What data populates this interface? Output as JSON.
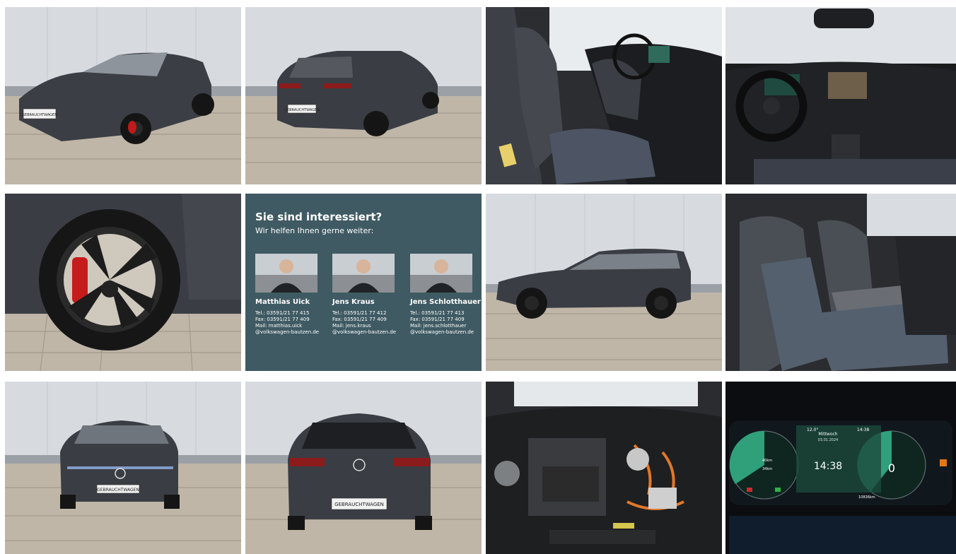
{
  "photos": [
    {
      "name": "front-three-quarter-photo",
      "plate": "GEBRAUCHTWAGEN"
    },
    {
      "name": "rear-three-quarter-photo",
      "plate": "GEBRAUCHTWAGEN"
    },
    {
      "name": "front-seats-photo"
    },
    {
      "name": "dashboard-photo"
    },
    {
      "name": "wheel-photo"
    },
    {
      "name": "side-profile-photo"
    },
    {
      "name": "rear-seats-photo"
    },
    {
      "name": "front-view-photo",
      "plate": "GEBRAUCHTWAGEN"
    },
    {
      "name": "rear-view-photo",
      "plate": "GEBRAUCHTWAGEN"
    },
    {
      "name": "engine-bay-photo"
    },
    {
      "name": "digital-cockpit-photo",
      "day": "Mittwoch",
      "date": "03.01.2024",
      "clock": "14:38",
      "temp": "12.0°",
      "speed": "0",
      "range1": "40km",
      "range2": "34km",
      "odo": "10836km",
      "time_top": "14:38"
    }
  ],
  "contact": {
    "title": "Sie sind interessiert?",
    "subtitle": "Wir helfen Ihnen gerne weiter:",
    "people": [
      {
        "name": "Matthias Uick",
        "tel": "Tel.:  03591/21 77 415",
        "fax": "Fax:  03591/21 77 409",
        "mail": "Mail: matthias.uick",
        "domain": "@volkswagen-bautzen.de"
      },
      {
        "name": "Jens Kraus",
        "tel": "Tel.:     03591/21 77 412",
        "fax": "Fax:     03591/21 77 409",
        "mail": "Mail:    jens.kraus",
        "domain": "@volkswagen-bautzen.de"
      },
      {
        "name": "Jens Schlotthauer",
        "tel": "Tel.:  03591/21 77 413",
        "fax": "Fax:  03591/21 77 409",
        "mail": "Mail: jens.schlotthauer",
        "domain": "@volkswagen-bautzen.de"
      }
    ]
  }
}
